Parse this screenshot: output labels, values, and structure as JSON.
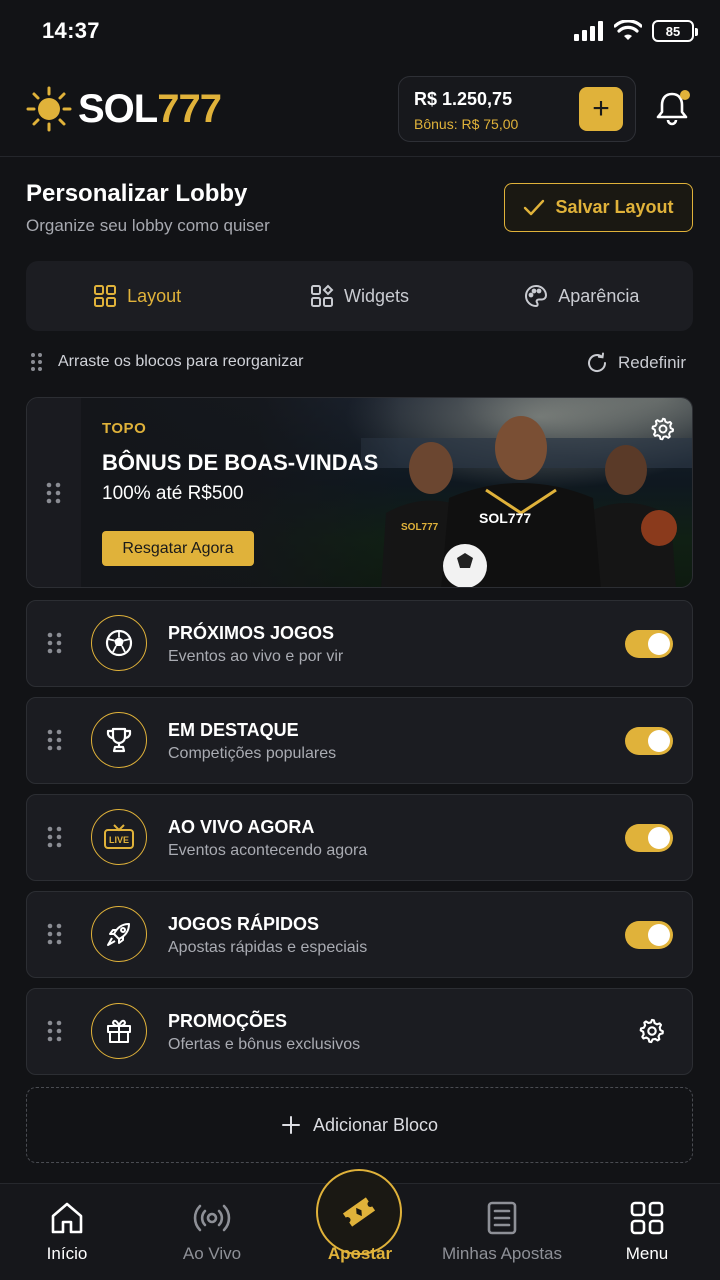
{
  "status": {
    "time": "14:37",
    "battery": "85"
  },
  "header": {
    "logo_sol": "SOL",
    "logo_num": "777",
    "balance": "R$ 1.250,75",
    "bonus": "Bônus: R$ 75,00",
    "add_funds": "+"
  },
  "page": {
    "title": "Personalizar Lobby",
    "subtitle": "Organize seu lobby como quiser",
    "save_label": "Salvar Layout"
  },
  "tabs": [
    {
      "label": "Layout",
      "icon": "layout-grid-icon",
      "active": true
    },
    {
      "label": "Widgets",
      "icon": "widgets-icon",
      "active": false
    },
    {
      "label": "Aparência",
      "icon": "palette-icon",
      "active": false
    }
  ],
  "hint": "Arraste os blocos para reorganizar",
  "reset_label": "Redefinir",
  "banner": {
    "tag": "TOPO",
    "title": "BÔNUS DE BOAS-VINDAS",
    "subtitle": "100% até R$500",
    "button": "Resgatar Agora",
    "jersey_text": "SOL777"
  },
  "blocks": [
    {
      "title": "PRÓXIMOS JOGOS",
      "subtitle": "Eventos ao vivo e por vir",
      "icon": "soccer-ball-icon",
      "control": "toggle",
      "enabled": true
    },
    {
      "title": "EM DESTAQUE",
      "subtitle": "Competições populares",
      "icon": "trophy-icon",
      "control": "toggle",
      "enabled": true
    },
    {
      "title": "AO VIVO AGORA",
      "subtitle": "Eventos acontecendo agora",
      "icon": "live-tv-icon",
      "icon_text": "LIVE",
      "control": "toggle",
      "enabled": true
    },
    {
      "title": "JOGOS RÁPIDOS",
      "subtitle": "Apostas rápidas e especiais",
      "icon": "rocket-icon",
      "control": "toggle",
      "enabled": true
    },
    {
      "title": "PROMOÇÕES",
      "subtitle": "Ofertas e bônus exclusivos",
      "icon": "gift-icon",
      "control": "gear"
    }
  ],
  "add_block": "Adicionar Bloco",
  "nav": [
    {
      "label": "Início",
      "icon": "home-icon"
    },
    {
      "label": "Ao Vivo",
      "icon": "broadcast-icon"
    },
    {
      "label": "Apostar",
      "icon": "ticket-icon",
      "active": true
    },
    {
      "label": "Minhas Apostas",
      "icon": "receipt-icon"
    },
    {
      "label": "Menu",
      "icon": "grid-menu-icon"
    }
  ],
  "colors": {
    "accent": "#E0B23A",
    "background": "#121316",
    "card": "#1b1c21"
  }
}
